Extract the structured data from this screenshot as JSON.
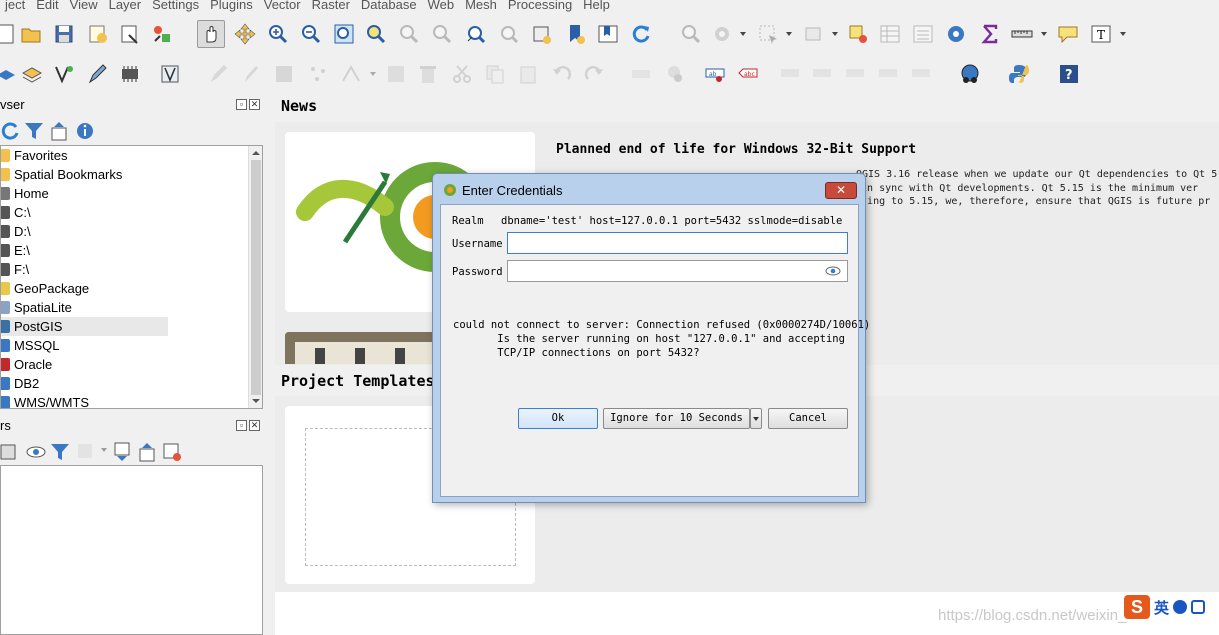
{
  "menu": [
    "ject",
    "Edit",
    "View",
    "Layer",
    "Settings",
    "Plugins",
    "Vector",
    "Raster",
    "Database",
    "Web",
    "Mesh",
    "Processing",
    "Help"
  ],
  "browser_panel": {
    "title": "vser",
    "items": [
      "Favorites",
      "Spatial Bookmarks",
      "Home",
      "C:\\",
      "D:\\",
      "E:\\",
      "F:\\",
      "GeoPackage",
      "SpatiaLite",
      "PostGIS",
      "MSSQL",
      "Oracle",
      "DB2",
      "WMS/WMTS"
    ],
    "selected": "PostGIS"
  },
  "layers_panel": {
    "title": "rs"
  },
  "news": {
    "title": "News",
    "heading": "Planned end of life for Windows 32-Bit Support",
    "body_lines": [
      "QGIS 3.16 release when we update our Qt dependencies to Qt 5",
      "g in sync with Qt developments. Qt 5.15 is the minimum ver",
      "dating to 5.15, we, therefore, ensure that QGIS is future pr"
    ]
  },
  "project_templates": {
    "title": "Project Templates"
  },
  "dialog": {
    "title": "Enter Credentials",
    "close_label": "✕",
    "realm_label": "Realm",
    "realm_value": "dbname='test' host=127.0.0.1 port=5432 sslmode=disable",
    "username_label": "Username",
    "username_value": "",
    "password_label": "Password",
    "password_value": "",
    "error_text": "could not connect to server: Connection refused (0x0000274D/10061)\n       Is the server running on host \"127.0.0.1\" and accepting\n       TCP/IP connections on port 5432?",
    "ok_label": "Ok",
    "ignore_label": "Ignore for 10 Seconds",
    "cancel_label": "Cancel"
  },
  "watermark": "https://blog.csdn.net/weixin_45",
  "ime": {
    "logo": "S",
    "text": "英"
  },
  "colors": {
    "accent": "#3c7fd4",
    "dialog_frame": "#b8d0ec",
    "close_red": "#c84a3a"
  }
}
